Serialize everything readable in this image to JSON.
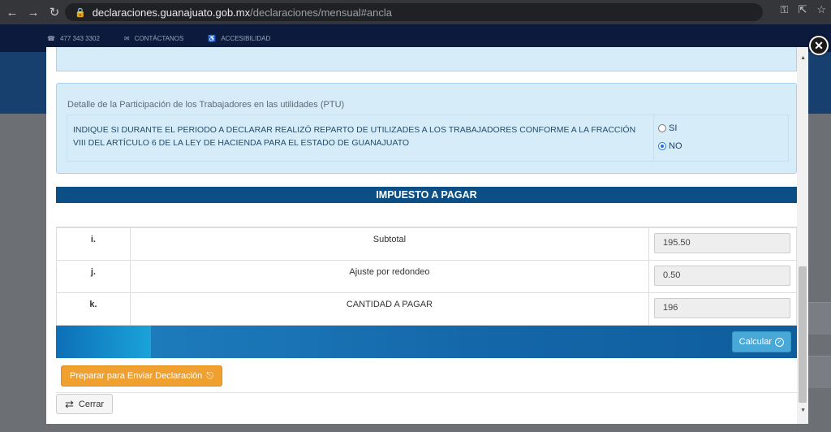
{
  "browser": {
    "url_host": "declaraciones.guanajuato.gob.mx",
    "url_path": "/declaraciones/mensual#ancla"
  },
  "site": {
    "phone": "477 343 3302",
    "contact": "CONTÁCTANOS",
    "accessibility": "ACCESIBILIDAD"
  },
  "ptu": {
    "title": "Detalle de la Participación de los Trabajadores en las utilidades (PTU)",
    "question": "INDIQUE SI DURANTE EL PERIODO A DECLARAR REALIZÓ REPARTO DE UTILIZADES A LOS TRABAJADORES CONFORME A LA FRACCIÓN VIII DEL ARTÍCULO 6 DE LA LEY DE HACIENDA PARA EL ESTADO DE GUANAJUATO",
    "options": [
      "SI",
      "NO"
    ],
    "selected": "NO"
  },
  "tax": {
    "header": "IMPUESTO A PAGAR",
    "rows": [
      {
        "letter": "i.",
        "label": "Subtotal",
        "value": "195.50"
      },
      {
        "letter": "j.",
        "label": "Ajuste por redondeo",
        "value": "0.50"
      },
      {
        "letter": "k.",
        "label": "CANTIDAD A PAGAR",
        "value": "196"
      }
    ]
  },
  "buttons": {
    "calcular": "Calcular",
    "preparar": "Preparar para Enviar Declaración",
    "cerrar": "Cerrar"
  },
  "colors": {
    "header_blue": "#0b4f86",
    "panel_bg": "#d6ecf8",
    "orange": "#f0a02e",
    "calc_blue": "#48a9d8"
  }
}
